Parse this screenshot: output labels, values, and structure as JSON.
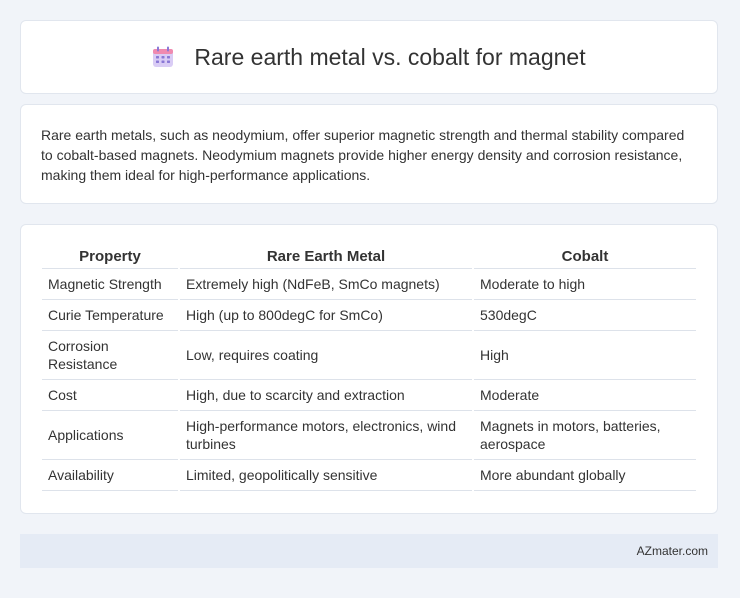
{
  "header": {
    "icon": "calendar-icon",
    "title": "Rare earth metal vs. cobalt for magnet"
  },
  "intro": {
    "text": "Rare earth metals, such as neodymium, offer superior magnetic strength and thermal stability compared to cobalt-based magnets. Neodymium magnets provide higher energy density and corrosion resistance, making them ideal for high-performance applications."
  },
  "table": {
    "headers": [
      "Property",
      "Rare Earth Metal",
      "Cobalt"
    ],
    "rows": [
      [
        "Magnetic Strength",
        "Extremely high (NdFeB, SmCo magnets)",
        "Moderate to high"
      ],
      [
        "Curie Temperature",
        "High (up to 800degC for SmCo)",
        "530degC"
      ],
      [
        "Corrosion Resistance",
        "Low, requires coating",
        "High"
      ],
      [
        "Cost",
        "High, due to scarcity and extraction",
        "Moderate"
      ],
      [
        "Applications",
        "High-performance motors, electronics, wind turbines",
        "Magnets in motors, batteries, aerospace"
      ],
      [
        "Availability",
        "Limited, geopolitically sensitive",
        "More abundant globally"
      ]
    ]
  },
  "footer": {
    "brand": "AZmater.com"
  },
  "colors": {
    "background": "#f1f4f9",
    "card": "#ffffff",
    "footer": "#e5ebf5",
    "icon_top": "#ef8ab0",
    "icon_body": "#cbb9ef",
    "icon_dots": "#8a78d6"
  }
}
